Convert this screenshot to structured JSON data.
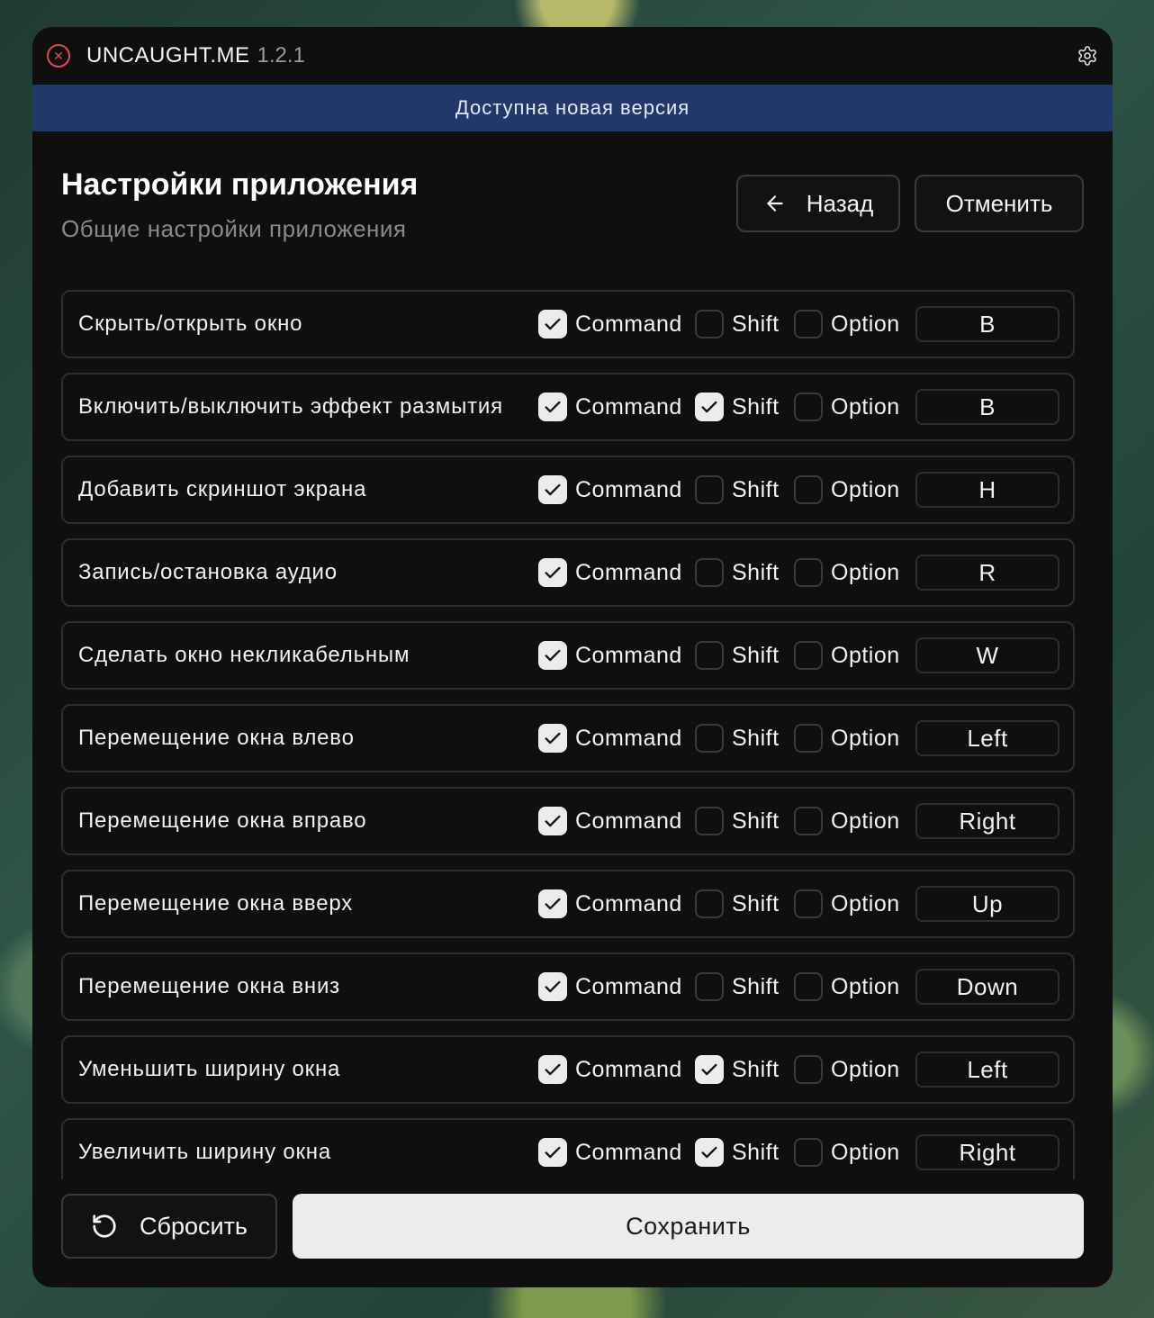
{
  "app": {
    "name": "UNCAUGHT.ME",
    "version": "1.2.1"
  },
  "banner": {
    "text": "Доступна новая версия"
  },
  "header": {
    "title": "Настройки приложения",
    "subtitle": "Общие настройки приложения",
    "back_label": "Назад",
    "cancel_label": "Отменить"
  },
  "modifier_labels": {
    "command": "Command",
    "shift": "Shift",
    "option": "Option"
  },
  "shortcuts": [
    {
      "label": "Скрыть/открыть окно",
      "command": true,
      "shift": false,
      "option": false,
      "key": "B"
    },
    {
      "label": "Включить/выключить эффект размытия",
      "command": true,
      "shift": true,
      "option": false,
      "key": "B"
    },
    {
      "label": "Добавить скриншот экрана",
      "command": true,
      "shift": false,
      "option": false,
      "key": "H"
    },
    {
      "label": "Запись/остановка аудио",
      "command": true,
      "shift": false,
      "option": false,
      "key": "R"
    },
    {
      "label": "Сделать окно некликабельным",
      "command": true,
      "shift": false,
      "option": false,
      "key": "W"
    },
    {
      "label": "Перемещение окна влево",
      "command": true,
      "shift": false,
      "option": false,
      "key": "Left"
    },
    {
      "label": "Перемещение окна вправо",
      "command": true,
      "shift": false,
      "option": false,
      "key": "Right"
    },
    {
      "label": "Перемещение окна вверх",
      "command": true,
      "shift": false,
      "option": false,
      "key": "Up"
    },
    {
      "label": "Перемещение окна вниз",
      "command": true,
      "shift": false,
      "option": false,
      "key": "Down"
    },
    {
      "label": "Уменьшить ширину окна",
      "command": true,
      "shift": true,
      "option": false,
      "key": "Left"
    },
    {
      "label": "Увеличить ширину окна",
      "command": true,
      "shift": true,
      "option": false,
      "key": "Right"
    }
  ],
  "footer": {
    "reset_label": "Сбросить",
    "save_label": "Сохранить"
  },
  "colors": {
    "window_bg": "#0f0f10",
    "banner_bg": "#22376a",
    "close_red": "#e5484d",
    "checked_fill": "#ececec",
    "save_bg": "#ececec"
  },
  "icons": {
    "close": "close-icon",
    "settings": "gear-icon",
    "back": "arrow-left-icon",
    "reset": "reset-icon",
    "check": "checkmark-icon"
  }
}
